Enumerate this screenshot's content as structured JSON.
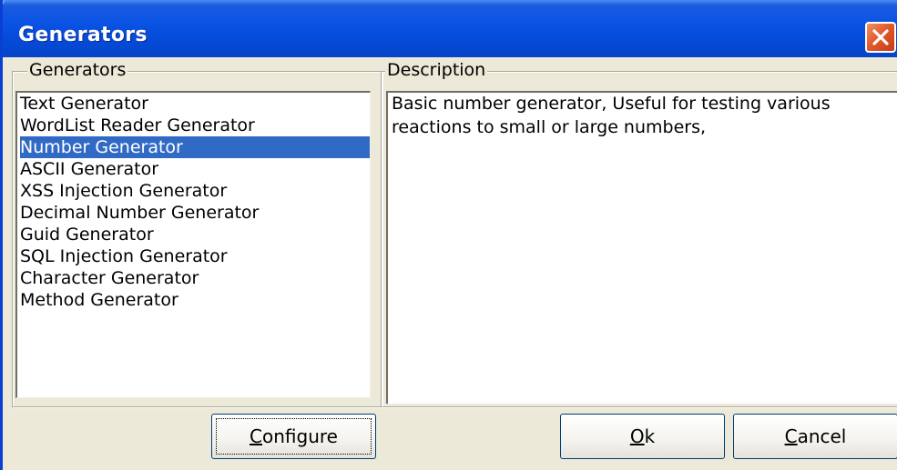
{
  "window": {
    "title": "Generators"
  },
  "generators_group": {
    "legend": "Generators",
    "items": [
      {
        "label": "Text Generator",
        "selected": false
      },
      {
        "label": "WordList Reader Generator",
        "selected": false
      },
      {
        "label": "Number Generator",
        "selected": true
      },
      {
        "label": "ASCII Generator",
        "selected": false
      },
      {
        "label": "XSS Injection Generator",
        "selected": false
      },
      {
        "label": "Decimal Number Generator",
        "selected": false
      },
      {
        "label": "Guid Generator",
        "selected": false
      },
      {
        "label": "SQL Injection Generator",
        "selected": false
      },
      {
        "label": "Character Generator",
        "selected": false
      },
      {
        "label": "Method Generator",
        "selected": false
      }
    ]
  },
  "description_group": {
    "legend": "Description",
    "text": "Basic number generator, Useful for testing various reactions to small or large numbers,"
  },
  "buttons": {
    "configure": {
      "mnemonic": "C",
      "rest": "onfigure"
    },
    "ok": {
      "mnemonic": "O",
      "rest": "k"
    },
    "cancel": {
      "mnemonic": "C",
      "rest": "ancel"
    }
  },
  "colors": {
    "titlebar": "#0549d6",
    "selection": "#316ac5",
    "close_button": "#e25a2c",
    "dialog_face": "#ece9d8"
  },
  "icons": {
    "close": "close-icon"
  }
}
